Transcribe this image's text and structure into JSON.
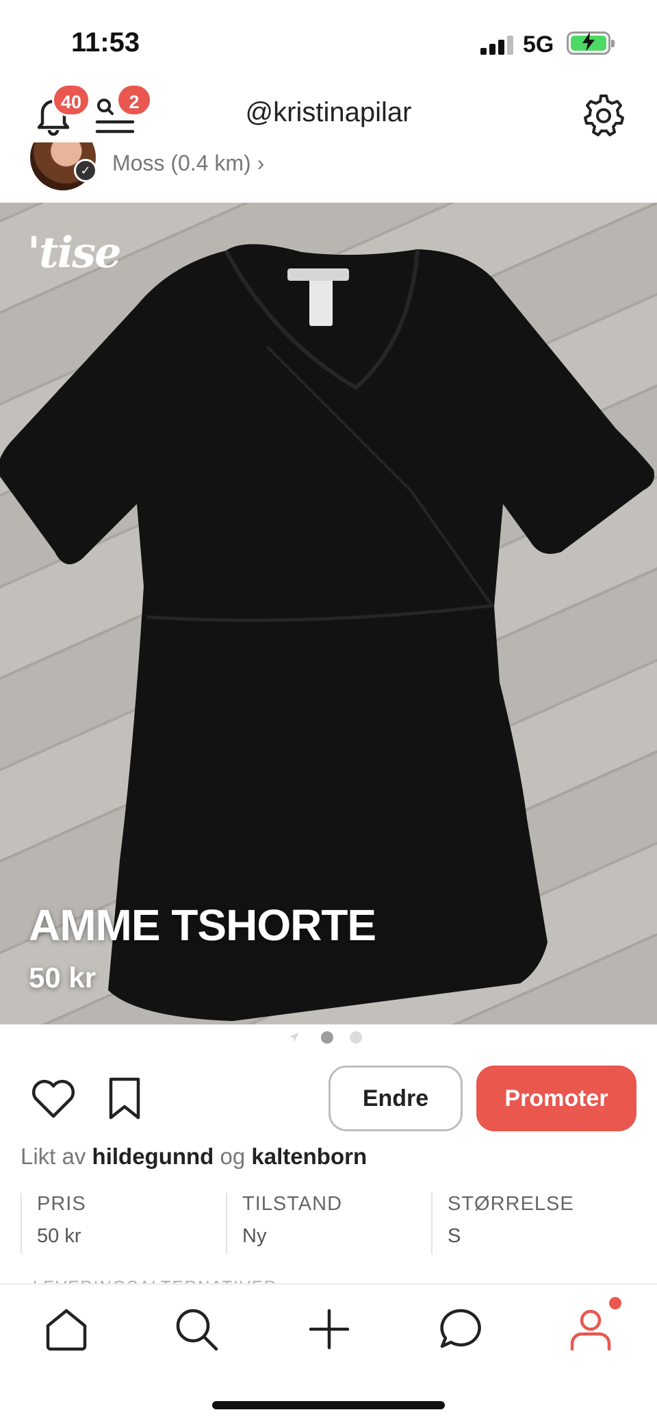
{
  "status_bar": {
    "time": "11:53",
    "network": "5G",
    "battery_charging": true,
    "signal_icon": "cellular-signal-icon",
    "battery_icon": "battery-charging-icon"
  },
  "header": {
    "notification_count": "40",
    "messages_count": "2",
    "username": "@kristinapilar",
    "icons": [
      "bell-icon",
      "search-menu-icon",
      "gear-icon"
    ]
  },
  "seller": {
    "location": "Moss (0.4 km) ›",
    "verified_icon": "checkmark-icon"
  },
  "listing": {
    "watermark": "'tise",
    "title": "AMME TSHORTE",
    "price": "50 kr",
    "image_count": 2,
    "current_image": 1
  },
  "actions": {
    "edit_label": "Endre",
    "promote_label": "Promoter",
    "icons": [
      "heart-icon",
      "bookmark-icon"
    ]
  },
  "likes": {
    "prefix": "Likt av",
    "user1": "hildegunnd",
    "conjunction": "og",
    "user2": "kaltenborn"
  },
  "details": [
    {
      "label": "PRIS",
      "value": "50 kr"
    },
    {
      "label": "TILSTAND",
      "value": "Ny"
    },
    {
      "label": "STØRRELSE",
      "value": "S"
    }
  ],
  "next_section_label": "LEVERINGSALTERNATIVER",
  "tabbar": {
    "items": [
      "home-icon",
      "search-icon",
      "add-icon",
      "chat-icon",
      "profile-icon"
    ],
    "active": "profile-icon"
  },
  "colors": {
    "accent": "#e9574f",
    "text": "#222222",
    "muted": "#777777",
    "divider": "#e3e3e3"
  }
}
